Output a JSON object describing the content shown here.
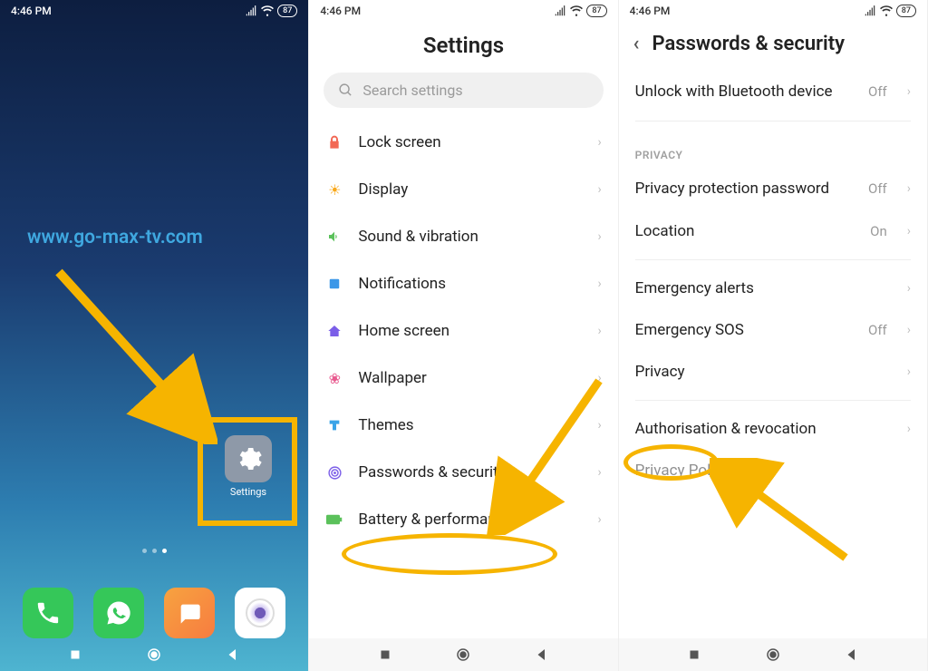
{
  "status": {
    "time": "4:46 PM",
    "battery": "87"
  },
  "phone1": {
    "watermark": "www.go-max-tv.com",
    "settings_label": "Settings"
  },
  "phone2": {
    "title": "Settings",
    "search_placeholder": "Search settings",
    "items": [
      {
        "label": "Lock screen",
        "icon_color": "#f26855"
      },
      {
        "label": "Display",
        "icon_color": "#f8a81b"
      },
      {
        "label": "Sound & vibration",
        "icon_color": "#5bc15b"
      },
      {
        "label": "Notifications",
        "icon_color": "#3a97e8"
      },
      {
        "label": "Home screen",
        "icon_color": "#7b5ee8"
      },
      {
        "label": "Wallpaper",
        "icon_color": "#e85a8f"
      },
      {
        "label": "Themes",
        "icon_color": "#3aa4e8"
      },
      {
        "label": "Passwords & security",
        "icon_color": "#7b5ee8"
      },
      {
        "label": "Battery & performance",
        "icon_color": "#5bc15b"
      }
    ]
  },
  "phone3": {
    "title": "Passwords & security",
    "rows": {
      "bluetooth": {
        "label": "Unlock with Bluetooth device",
        "value": "Off"
      },
      "section_privacy": "PRIVACY",
      "ppp": {
        "label": "Privacy protection password",
        "value": "Off"
      },
      "location": {
        "label": "Location",
        "value": "On"
      },
      "alerts": {
        "label": "Emergency alerts"
      },
      "sos": {
        "label": "Emergency SOS",
        "value": "Off"
      },
      "privacy": {
        "label": "Privacy"
      },
      "auth": {
        "label": "Authorisation & revocation"
      },
      "policy": {
        "label": "Privacy Policy"
      }
    }
  }
}
